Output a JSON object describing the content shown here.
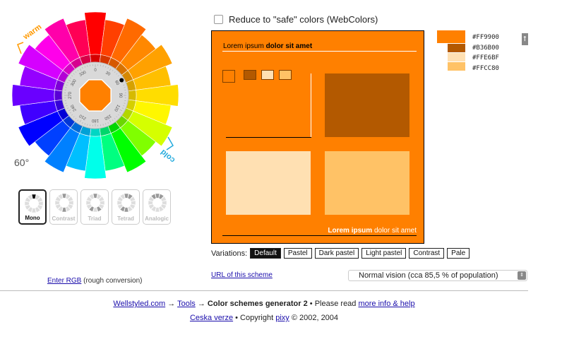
{
  "wheel": {
    "warm_label": "warm",
    "cold_label": "cold",
    "angle": "60°",
    "degrees": [
      "0",
      "30",
      "60",
      "90",
      "120",
      "150",
      "180",
      "210",
      "240",
      "270",
      "300",
      "330"
    ],
    "center_color": "#FF8000"
  },
  "modes": [
    {
      "label": "Mono",
      "active": true
    },
    {
      "label": "Contrast",
      "active": false
    },
    {
      "label": "Triad",
      "active": false
    },
    {
      "label": "Tetrad",
      "active": false
    },
    {
      "label": "Analogic",
      "active": false
    }
  ],
  "enter_rgb": {
    "link": "Enter RGB",
    "note": "(rough conversion)"
  },
  "reduce": {
    "label": "Reduce to \"safe\" colors (WebColors)",
    "checked": false
  },
  "preview": {
    "head_normal": "Lorem ipsum ",
    "head_bold": "dolor sit amet",
    "foot_bold": "Lorem ipsum",
    "foot_normal": " dolor sit amet",
    "colors": {
      "main": "#FF8000",
      "dark": "#B35900",
      "pale": "#FFE0B2",
      "light": "#FFC266"
    }
  },
  "palette": [
    {
      "hex": "#FF9900",
      "color": "#FF8000"
    },
    {
      "hex": "#B36B00",
      "color": "#B35900"
    },
    {
      "hex": "#FFE6BF",
      "color": "#FFE0B2"
    },
    {
      "hex": "#FFCC80",
      "color": "#FFC266"
    }
  ],
  "arrow_glyph": "⭡",
  "variations": {
    "label": "Variations:",
    "buttons": [
      {
        "label": "Default",
        "active": true
      },
      {
        "label": "Pastel",
        "active": false
      },
      {
        "label": "Dark pastel",
        "active": false
      },
      {
        "label": "Light pastel",
        "active": false
      },
      {
        "label": "Contrast",
        "active": false
      },
      {
        "label": "Pale",
        "active": false
      }
    ]
  },
  "url_link": "URL of this scheme",
  "vision_select": {
    "value": "Normal vision (cca 85,5 % of population)"
  },
  "footer": {
    "site": "Wellstyled.com",
    "arrow1": " → ",
    "tools": "Tools",
    "arrow2": " → ",
    "title": "Color schemes generator 2",
    "please": " • Please read ",
    "more": "more info & help",
    "ceska": "Ceska verze",
    "copy1": " • Copyright ",
    "pixy": "pixy",
    "copy2": " © 2002, 2004"
  }
}
